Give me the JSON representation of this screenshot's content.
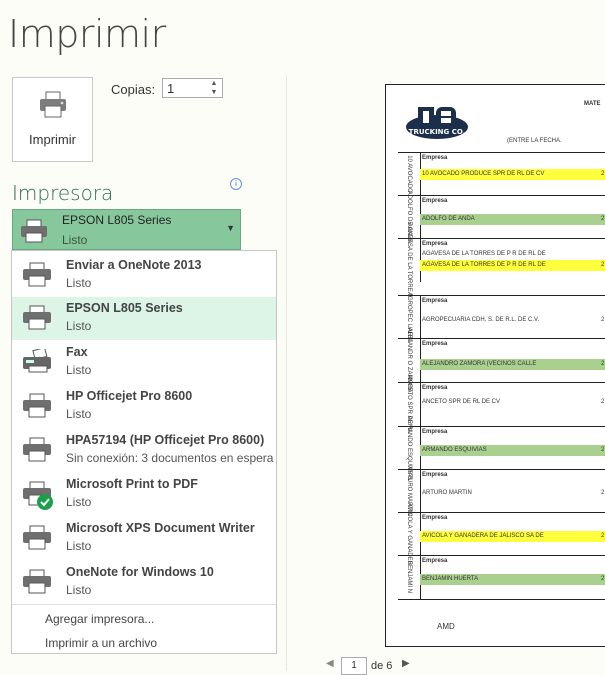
{
  "header": {
    "title": "Imprimir"
  },
  "print_button": {
    "label": "Imprimir"
  },
  "copies": {
    "label": "Copias:",
    "value": "1"
  },
  "printer_section": {
    "title": "Impresora",
    "info_icon": "info-icon",
    "selected": {
      "name": "EPSON L805 Series",
      "status": "Listo"
    }
  },
  "printers": [
    {
      "name": "Enviar a OneNote 2013",
      "status": "Listo",
      "icon": "printer-icon"
    },
    {
      "name": "EPSON L805 Series",
      "status": "Listo",
      "icon": "printer-icon"
    },
    {
      "name": "Fax",
      "status": "Listo",
      "icon": "fax-icon"
    },
    {
      "name": "HP Officejet Pro 8600",
      "status": "Listo",
      "icon": "printer-icon"
    },
    {
      "name": "HPA57194 (HP Officejet Pro 8600)",
      "status": "Sin conexión: 3 documentos en espera",
      "icon": "printer-icon"
    },
    {
      "name": "Microsoft Print to PDF",
      "status": "Listo",
      "icon": "printer-default-icon"
    },
    {
      "name": "Microsoft XPS Document Writer",
      "status": "Listo",
      "icon": "printer-icon"
    },
    {
      "name": "OneNote for Windows 10",
      "status": "Listo",
      "icon": "printer-icon"
    }
  ],
  "footer_links": {
    "add": "Agregar impresora...",
    "file": "Imprimir a un archivo"
  },
  "preview": {
    "header_right": "MATE",
    "subtitle": "(ENTRE LA FECHA.",
    "logo_text": "TRUCKING CO.",
    "rows": [
      {
        "vert": "10 AVOCADO",
        "empresa": "Empresa",
        "value": "10 AVOCADO PRODUCE SPR DE RL DE CV",
        "color": "yellow",
        "num": "2"
      },
      {
        "vert": "ADOLFO DE ANDA",
        "empresa": "Empresa",
        "value": "ADOLFO DE ANDA",
        "color": "green",
        "num": "2"
      },
      {
        "vert": "AGAVESA DE LA TORRE S",
        "empresa": "Empresa",
        "value": "AGAVESA DE LA TORRES DE P R DE RL DE",
        "value2": "AGAVESA DE LA TORRES DE P R DE RL DE",
        "color": "yellow",
        "num": "2"
      },
      {
        "vert": "AGROPEC UARIA",
        "empresa": "Empresa",
        "value": "AGROPECUARIA CDH, S. DE R.L. DE C.V.",
        "color": "none",
        "num": "2"
      },
      {
        "vert": "ALEJANDR O ZAMORA",
        "empresa": "Empresa",
        "value": "ALEJANDRO ZAMORA (VECINOS CALLE",
        "color": "green",
        "num": "2"
      },
      {
        "vert": "ANCETO SPR DE RL",
        "empresa": "Empresa",
        "value": "ANCETO SPR DE RL DE CV",
        "color": "none",
        "num": "2"
      },
      {
        "vert": "ARMANDO ESQUIVIAS",
        "empresa": "Empresa",
        "value": "ARMANDO ESQUIVIAS",
        "color": "green",
        "num": "2"
      },
      {
        "vert": "ARTURO MARTIN",
        "empresa": "Empresa",
        "value": "ARTURO MARTIN",
        "color": "none",
        "num": "2"
      },
      {
        "vert": "AVICOLA Y GANADER",
        "empresa": "Empresa",
        "value": "AVICOLA Y GANADERA DE JALISCO SA DE",
        "color": "yellow",
        "num": "2"
      },
      {
        "vert": "BENJAMI N",
        "empresa": "Empresa",
        "value": "BENJAMIN HUERTA",
        "color": "green",
        "num": "2"
      }
    ],
    "footer": "AMD"
  },
  "pager": {
    "current": "1",
    "of_label": "de 6"
  },
  "colors": {
    "accent": "#2e6f4e",
    "selected_bg": "#87c79c",
    "hover_bg": "#ddf5e7",
    "yellow": "#ffff3c",
    "green": "#a9d08e"
  }
}
